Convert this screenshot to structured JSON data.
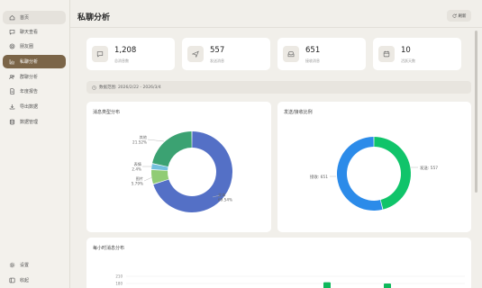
{
  "sidebar": {
    "items": [
      {
        "label": "首页",
        "icon": "home-icon"
      },
      {
        "label": "聊天查看",
        "icon": "chat-icon"
      },
      {
        "label": "朋友圈",
        "icon": "moments-icon"
      },
      {
        "label": "私聊分析",
        "icon": "chart-icon"
      },
      {
        "label": "群聊分析",
        "icon": "group-icon"
      },
      {
        "label": "年度报告",
        "icon": "report-icon"
      },
      {
        "label": "导出数据",
        "icon": "download-icon"
      },
      {
        "label": "数据管理",
        "icon": "database-icon"
      }
    ],
    "active_index": 3,
    "bottom_items": [
      {
        "label": "设置",
        "icon": "gear-icon"
      },
      {
        "label": "收起",
        "icon": "collapse-icon"
      }
    ]
  },
  "header": {
    "title": "私聊分析",
    "refresh_label": "刷新"
  },
  "stats": [
    {
      "value": "1,208",
      "label": "总消息数",
      "icon": "message-icon"
    },
    {
      "value": "557",
      "label": "发送消息",
      "icon": "send-icon"
    },
    {
      "value": "651",
      "label": "接收消息",
      "icon": "inbox-icon"
    },
    {
      "value": "10",
      "label": "活跃天数",
      "icon": "calendar-icon"
    }
  ],
  "date_range": {
    "text": "数据范围: 2026/2/22 - 2026/3/4",
    "icon": "clock-icon"
  },
  "panels": {
    "message_types_title": "消息类型分布",
    "send_receive_title": "发送/接收比例",
    "hourly_title": "每小时消息分布"
  },
  "colors": {
    "accent": "#7b6548",
    "text_blue": "#5470c6",
    "image_green": "#91cc75",
    "emoji_blue": "#73c0de",
    "voice_green": "#3ba272",
    "send_green": "#10c46a",
    "receive_blue": "#2c8be9",
    "bar_green": "#0fb85c"
  },
  "chart_data": [
    {
      "type": "pie",
      "title": "消息类型分布",
      "categories": [
        "文本",
        "图片",
        "表情",
        "其他"
      ],
      "values": [
        69.54,
        5.79,
        2.4,
        21.52
      ],
      "labels": [
        {
          "name": "文本",
          "percent": "69.54%"
        },
        {
          "name": "图片",
          "percent": "5.79%"
        },
        {
          "name": "表情",
          "percent": "2.4%"
        },
        {
          "name": "其他",
          "percent": "21.52%"
        }
      ]
    },
    {
      "type": "pie",
      "title": "发送/接收比例",
      "categories": [
        "发送",
        "接收"
      ],
      "values": [
        557,
        651
      ],
      "labels": [
        {
          "name": "发送",
          "value": "557",
          "text": "发送: 557"
        },
        {
          "name": "接收",
          "value": "651",
          "text": "接收: 651"
        }
      ]
    },
    {
      "type": "bar",
      "title": "每小时消息分布",
      "y_ticks": [
        "210",
        "180"
      ],
      "visible_bar_values": [
        185,
        180
      ]
    }
  ]
}
